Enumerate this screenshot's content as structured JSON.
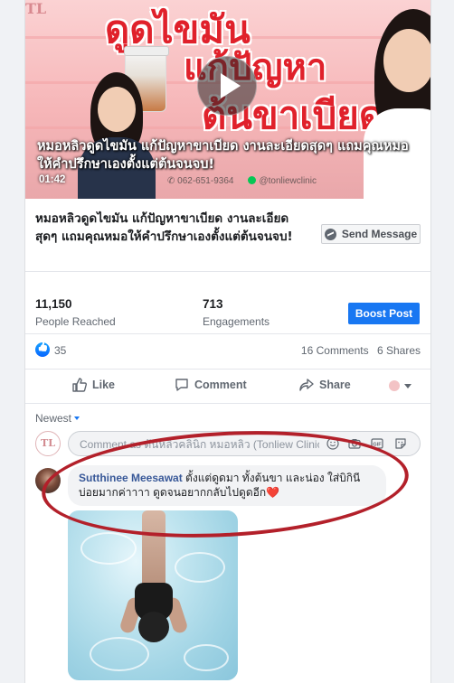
{
  "video": {
    "promo_line1": "ดูดไขมัน",
    "promo_line2": "แก้ปัญหา",
    "promo_line3": "ต้นขาเบียด",
    "overlay_title": "หมอหลิวดูดไขมัน แก้ปัญหาขาเบียด งานละเอียดสุดๆ แถมคุณหมอให้คำปรึกษาเองตั้งแต่ต้นจนจบ!",
    "duration": "01:42",
    "phone": "062-651-9364",
    "line_id": "@tonliewclinic",
    "logo": "TL"
  },
  "post": {
    "heading": "หมอหลิวดูดไขมัน แก้ปัญหาขาเบียด งานละเอียดสุดๆ แถมคุณหมอให้คำปรึกษาเองตั้งแต่ต้นจนจบ!",
    "send_message_label": "Send Message"
  },
  "stats": {
    "reached_value": "11,150",
    "reached_label": "People Reached",
    "engagement_value": "713",
    "engagement_label": "Engagements",
    "boost_label": "Boost Post"
  },
  "reactions": {
    "count": "35",
    "comments": "16 Comments",
    "shares": "6 Shares"
  },
  "actions": {
    "like": "Like",
    "comment": "Comment",
    "share": "Share"
  },
  "comments_section": {
    "sort_label": "Newest",
    "composer_placeholder": "Comment as ต้นหลิวคลินิก หมอหลิว (Tonliew Clinic)",
    "composer_avatar": "TL",
    "comment": {
      "author": "Sutthinee Meesawat",
      "text": "ตั้งแต่ดูดมา ทั้งต้นขา และน่อง ใส่บิกินีบ่อยมากค่าาาา ดูดจนอยากกลับไปดูดอีก",
      "emoji": "❤️"
    }
  },
  "colors": {
    "accent": "#1877f2",
    "author_link": "#385898",
    "highlight_ring": "#b3202a",
    "promo_text": "#e0212b"
  }
}
